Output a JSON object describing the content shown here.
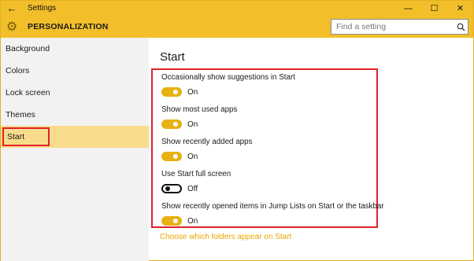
{
  "window": {
    "title": "Settings",
    "back_glyph": "←",
    "controls": {
      "minimize": "—",
      "maximize": "☐",
      "close": "✕"
    }
  },
  "header": {
    "section_title": "PERSONALIZATION",
    "gear_glyph": "⚙",
    "search": {
      "placeholder": "Find a setting",
      "icon": "search-icon",
      "value": ""
    }
  },
  "sidebar": {
    "items": [
      {
        "label": "Background"
      },
      {
        "label": "Colors"
      },
      {
        "label": "Lock screen"
      },
      {
        "label": "Themes"
      },
      {
        "label": "Start",
        "selected": true
      }
    ]
  },
  "main": {
    "title": "Start",
    "settings": [
      {
        "label": "Occasionally show suggestions in Start",
        "state": "On",
        "on": true
      },
      {
        "label": "Show most used apps",
        "state": "On",
        "on": true
      },
      {
        "label": "Show recently added apps",
        "state": "On",
        "on": true
      },
      {
        "label": "Use Start full screen",
        "state": "Off",
        "on": false
      },
      {
        "label": "Show recently opened items in Jump Lists on Start or the taskbar",
        "state": "On",
        "on": true
      }
    ],
    "link": "Choose which folders appear on Start"
  },
  "colors": {
    "accent": "#f2bf2b",
    "toggle_on": "#e8b010",
    "highlight_box": "#e1202a",
    "link": "#e8a800",
    "selected_nav": "#f8dc8c"
  }
}
